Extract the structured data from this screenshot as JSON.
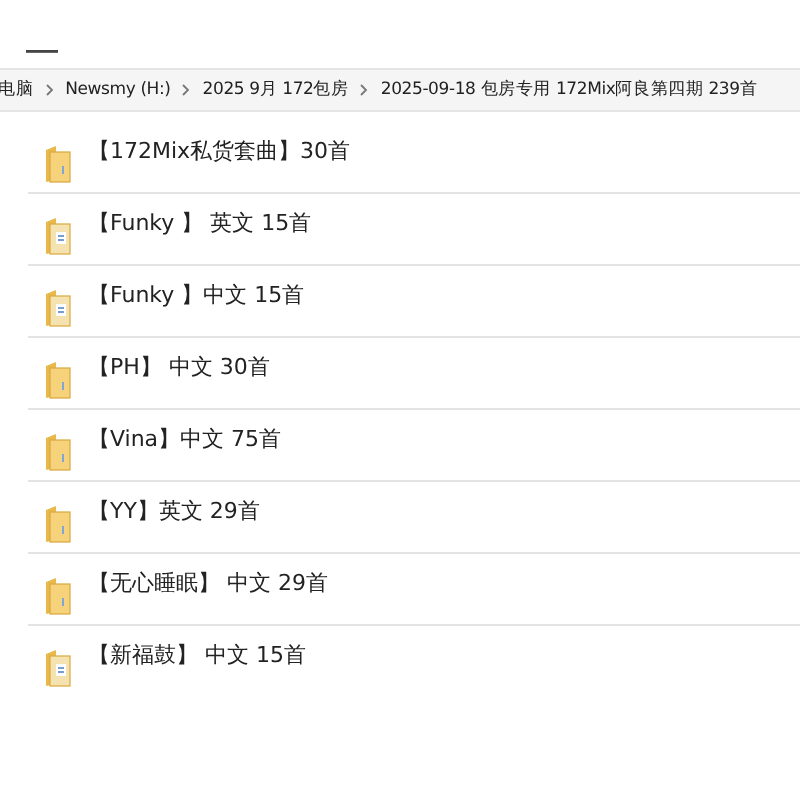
{
  "breadcrumb": [
    "电脑",
    "Newsmy (H:)",
    "2025 9月 172包房",
    "2025-09-18 包房专用  172Mix阿良第四期 239首"
  ],
  "items": [
    {
      "name": "【172Mix私货套曲】30首",
      "kind": "folder"
    },
    {
      "name": "【Funky 】 英文 15首",
      "kind": "folder-doc"
    },
    {
      "name": "【Funky 】中文 15首",
      "kind": "folder-doc"
    },
    {
      "name": "【PH】 中文 30首",
      "kind": "folder"
    },
    {
      "name": "【Vina】中文 75首",
      "kind": "folder"
    },
    {
      "name": "【YY】英文 29首",
      "kind": "folder"
    },
    {
      "name": "【无心睡眠】 中文 29首",
      "kind": "folder"
    },
    {
      "name": "【新福鼓】 中文 15首",
      "kind": "folder-doc"
    }
  ]
}
